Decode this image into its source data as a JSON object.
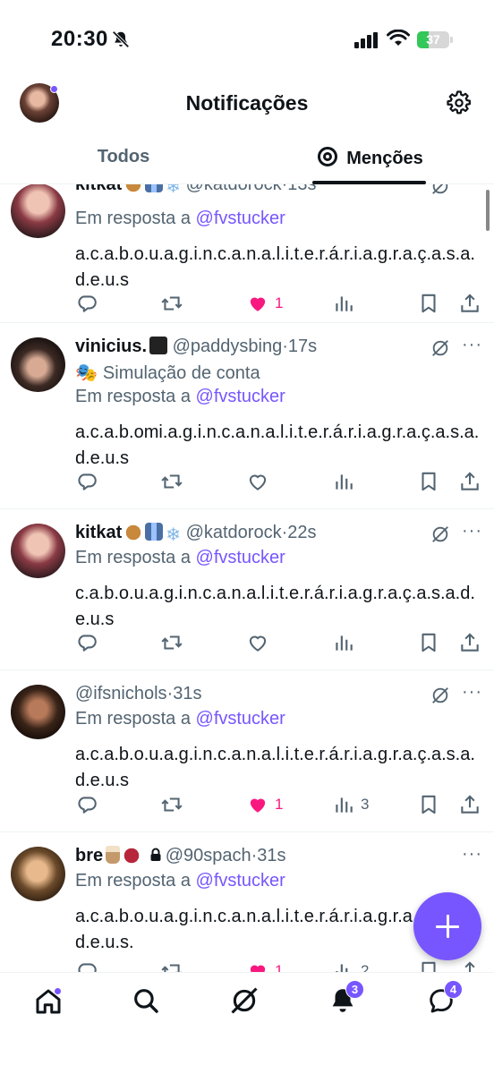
{
  "status": {
    "time": "20:30",
    "battery": "37",
    "battery_level": 0.37
  },
  "header": {
    "title": "Notificações"
  },
  "tabs": {
    "all": "Todos",
    "mentions": "Menções"
  },
  "posts": [
    {
      "name": "kitkat",
      "handle": "@katdorock",
      "sep": "·",
      "time": "13s",
      "reply_prefix": "Em resposta a",
      "reply_to": "@fvstucker",
      "body": "a.c.a.b.o.u.a.g.i.n.c.a.n.a.l.i.t.e.r.á.r.i.a.g.r.a.ç.a.s.a.d.e.u.s",
      "likes": "1",
      "views": ""
    },
    {
      "name": "vinicius.",
      "handle": "@paddysbing",
      "sep": "·",
      "time": "17s",
      "simulation": "Simulação de conta",
      "reply_prefix": "Em resposta a",
      "reply_to": "@fvstucker",
      "body": "a.c.a.b.omi.a.g.i.n.c.a.n.a.l.i.t.e.r.á.r.i.a.g.r.a.ç.a.s.a.d.e.u.s",
      "likes": "",
      "views": ""
    },
    {
      "name": "kitkat",
      "handle": "@katdorock",
      "sep": "·",
      "time": "22s",
      "reply_prefix": "Em resposta a",
      "reply_to": "@fvstucker",
      "body": "c.a.b.o.u.a.g.i.n.c.a.n.a.l.i.t.e.r.á.r.i.a.g.r.a.ç.a.s.a.d.e.u.s",
      "likes": "",
      "views": ""
    },
    {
      "name": "",
      "handle": "@ifsnichols",
      "sep": "·",
      "time": "31s",
      "reply_prefix": "Em resposta a",
      "reply_to": "@fvstucker",
      "body": "a.c.a.b.o.u.a.g.i.n.c.a.n.a.l.i.t.e.r.á.r.i.a.g.r.a.ç.a.s.a.d.e.u.s",
      "likes": "1",
      "views": "3"
    },
    {
      "name": "bre",
      "handle": "@90spach",
      "sep": "·",
      "time": "31s",
      "reply_prefix": "Em resposta a",
      "reply_to": "@fvstucker",
      "body": "a.c.a.b.o.u.a.g.i.n.c.a.n.a.l.i.t.e.r.á.r.i.a.g.r.a.ç.a.s.a.d.e.u.s.",
      "likes": "1",
      "views": "2"
    }
  ],
  "nav": {
    "notifications_badge": "3",
    "messages_badge": "4"
  },
  "colors": {
    "accent": "#7856ff",
    "like": "#f91880",
    "text": "#0f1419",
    "muted": "#536471"
  },
  "icons": [
    "bell-off-icon",
    "signal-icon",
    "wifi-icon",
    "battery-icon",
    "gear-icon",
    "at-icon",
    "reply-icon",
    "retweet-icon",
    "heart-icon",
    "views-icon",
    "bookmark-icon",
    "share-icon",
    "grok-icon",
    "more-icon",
    "home-icon",
    "search-icon",
    "notifications-icon",
    "messages-icon",
    "compose-icon"
  ]
}
